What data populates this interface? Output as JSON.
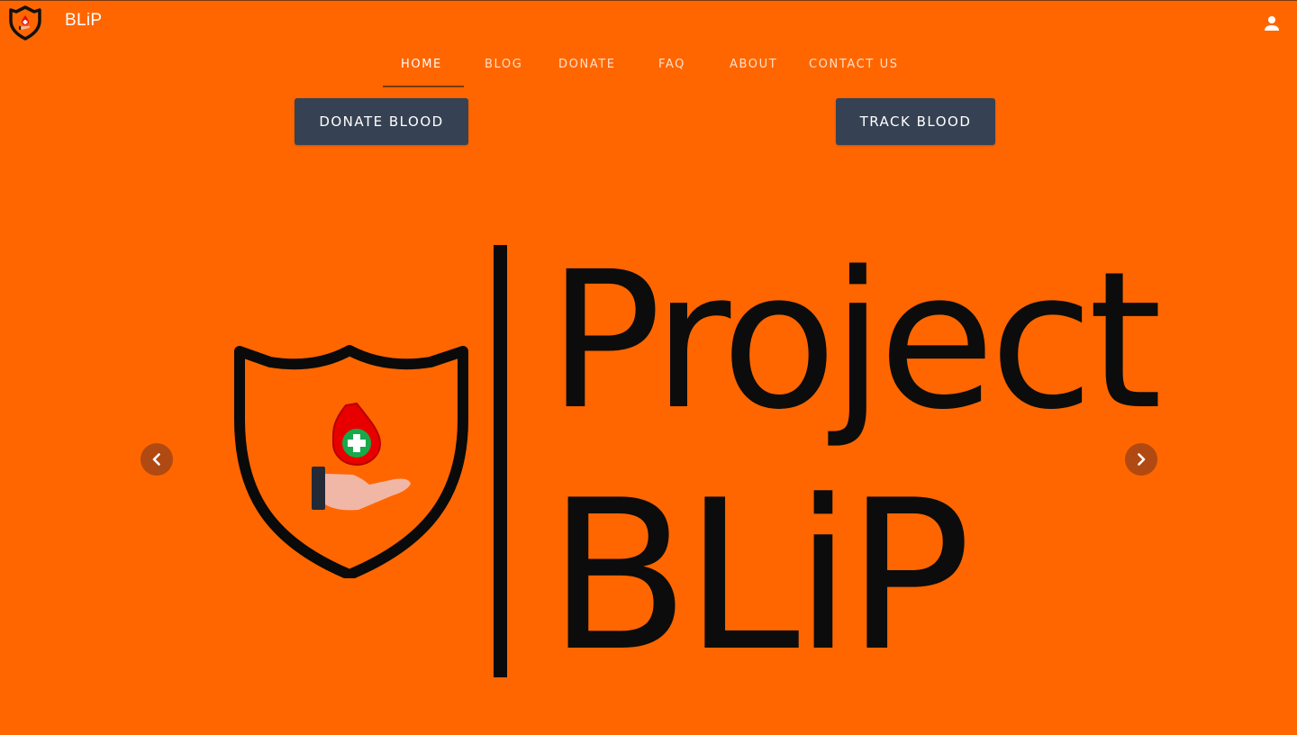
{
  "app": {
    "brand_name": "BLiP"
  },
  "nav": {
    "items": [
      {
        "label": "HOME",
        "active": true
      },
      {
        "label": "BLOG",
        "active": false
      },
      {
        "label": "DONATE",
        "active": false
      },
      {
        "label": "FAQ",
        "active": false
      },
      {
        "label": "ABOUT",
        "active": false
      },
      {
        "label": "CONTACT US",
        "active": false
      }
    ]
  },
  "actions": {
    "donate_label": "DONATE BLOOD",
    "track_label": "TRACK BLOOD"
  },
  "carousel": {
    "slide_title_line1": "Project",
    "slide_title_line2": "BLiP",
    "prev_icon": "chevron-left-icon",
    "next_icon": "chevron-right-icon"
  },
  "header": {
    "user_icon": "user-icon"
  },
  "colors": {
    "background": "#ff6600",
    "button_bg": "#364253",
    "arrow_bg": "#b04a12",
    "text_dark": "#0c0c0c"
  }
}
